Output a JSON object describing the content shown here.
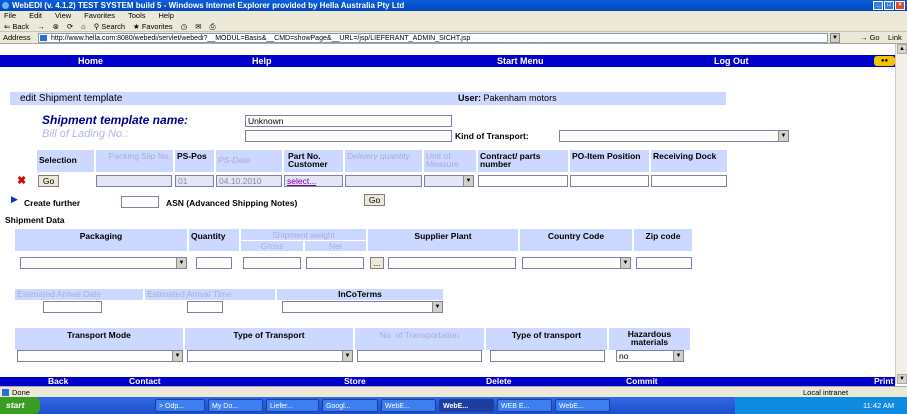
{
  "window": {
    "title": "WebEDI (v. 4.1.2) TEST SYSTEM build 5 - Windows Internet Explorer provided by Hella Australia Pty Ltd"
  },
  "menu": [
    "File",
    "Edit",
    "View",
    "Favorites",
    "Tools",
    "Help"
  ],
  "toolbar": {
    "back": "Back",
    "search": "Search",
    "favorites": "Favorites"
  },
  "address": {
    "label": "Address",
    "url": "http://www.hella.com:8080/webedi/servlet/webedi?__MODUL=Basis&__CMD=showPage&__URL=/jsp/LIEFERANT_ADMIN_SICHT.jsp",
    "go": "Go",
    "links": "Link"
  },
  "nav": {
    "home": "Home",
    "help": "Help",
    "start_menu": "Start Menu",
    "logout": "Log Out"
  },
  "header": {
    "title": "edit  Shipment template",
    "user_label": "User:",
    "user_value": "Pakenham motors"
  },
  "form": {
    "template_name_label": "Shipment template name:",
    "template_name_value": "Unknown",
    "bill_of_lading_label": "Bill of Lading No.:",
    "kind_of_transport_label": "Kind of Transport:"
  },
  "table": {
    "headers": {
      "selection": "Selection",
      "packing_slip": "Packing Slip No.",
      "ps_pos": "PS-Pos",
      "ps_date": "PS-Date",
      "part_no": "Part No. Customer",
      "delivery_qty": "Delivery quantity",
      "unit_of_measure": "Unit of Measure",
      "contract_parts": "Contract/ parts number",
      "po_item": "PO-Item Position",
      "receiving_dock": "Receiving Dock"
    },
    "row": {
      "go": "Go",
      "ps_pos": "01",
      "ps_date": "04.10.2010",
      "part_select": "select..."
    }
  },
  "create_further": {
    "label": "Create further",
    "asn_label": "ASN (Advanced Shipping Notes)",
    "go": "Go"
  },
  "shipment_data": {
    "title": "Shipment Data",
    "packaging": "Packaging",
    "quantity": "Quantity",
    "shipment_weight": "Shipment weight",
    "gross": "Gross",
    "net": "Net",
    "supplier_plant": "Supplier Plant",
    "country_code": "Country Code",
    "zip_code": "Zip code",
    "dots": "..."
  },
  "arrival": {
    "date_label": "Estimated Arrival Date",
    "time_label": "Estimated Arrival Time",
    "incoterms_label": "InCoTerms"
  },
  "transport": {
    "mode": "Transport Mode",
    "type": "Type of Transport",
    "no_of_transportation": "No. of Transportation",
    "type_lower": "Type of transport",
    "hazardous": "Hazardous materials",
    "hazardous_value": "no"
  },
  "bottom_nav": {
    "back": "Back",
    "contact": "Contact",
    "store": "Store",
    "delete": "Delete",
    "commit": "Commit",
    "print": "Print"
  },
  "status": {
    "done": "Done",
    "zone": "Local intranet"
  },
  "taskbar": {
    "start": "start",
    "tasks": [
      "> Odp...",
      "My Do...",
      "Liefer...",
      "Googl...",
      "WebE...",
      "WebE...",
      "WEB E...",
      "WebE..."
    ],
    "clock": "11:42 AM"
  }
}
